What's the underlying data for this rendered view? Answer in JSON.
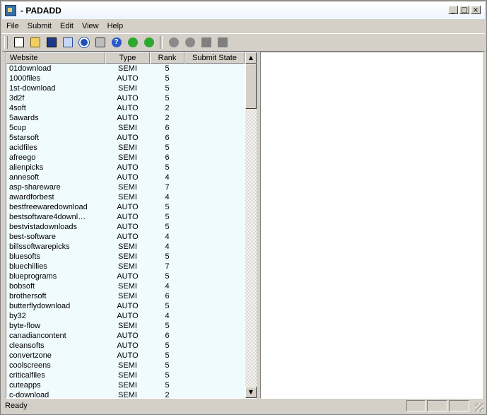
{
  "window": {
    "title": "- PADADD",
    "min": "_",
    "max": "□",
    "close": "×"
  },
  "menu": [
    "File",
    "Submit",
    "Edit",
    "View",
    "Help"
  ],
  "list": {
    "headers": {
      "website": "Website",
      "type": "Type",
      "rank": "Rank",
      "state": "Submit State"
    },
    "rows": [
      [
        "01download",
        "SEMI",
        "5"
      ],
      [
        "1000files",
        "AUTO",
        "5"
      ],
      [
        "1st-download",
        "SEMI",
        "5"
      ],
      [
        "3d2f",
        "AUTO",
        "5"
      ],
      [
        "4soft",
        "AUTO",
        "2"
      ],
      [
        "5awards",
        "AUTO",
        "2"
      ],
      [
        "5cup",
        "SEMI",
        "6"
      ],
      [
        "5starsoft",
        "AUTO",
        "6"
      ],
      [
        "acidfiles",
        "SEMI",
        "5"
      ],
      [
        "afreego",
        "SEMI",
        "6"
      ],
      [
        "alienpicks",
        "AUTO",
        "5"
      ],
      [
        "annesoft",
        "AUTO",
        "4"
      ],
      [
        "asp-shareware",
        "SEMI",
        "7"
      ],
      [
        "awardforbest",
        "SEMI",
        "4"
      ],
      [
        "bestfreewaredownload",
        "AUTO",
        "5"
      ],
      [
        "bestsoftware4downl…",
        "AUTO",
        "5"
      ],
      [
        "bestvistadownloads",
        "AUTO",
        "5"
      ],
      [
        "best-software",
        "AUTO",
        "4"
      ],
      [
        "billssoftwarepicks",
        "SEMI",
        "4"
      ],
      [
        "bluesofts",
        "SEMI",
        "5"
      ],
      [
        "bluechillies",
        "SEMI",
        "7"
      ],
      [
        "blueprograms",
        "AUTO",
        "5"
      ],
      [
        "bobsoft",
        "SEMI",
        "4"
      ],
      [
        "brothersoft",
        "SEMI",
        "6"
      ],
      [
        "butterflydownload",
        "AUTO",
        "5"
      ],
      [
        "by32",
        "AUTO",
        "4"
      ],
      [
        "byte-flow",
        "SEMI",
        "5"
      ],
      [
        "canadiancontent",
        "AUTO",
        "6"
      ],
      [
        "cleansofts",
        "AUTO",
        "5"
      ],
      [
        "convertzone",
        "AUTO",
        "5"
      ],
      [
        "coolscreens",
        "SEMI",
        "5"
      ],
      [
        "criticalfiles",
        "SEMI",
        "5"
      ],
      [
        "cuteapps",
        "SEMI",
        "5"
      ],
      [
        "c-download",
        "SEMI",
        "2"
      ]
    ]
  },
  "scroll": {
    "up": "▲",
    "down": "▼"
  },
  "status": {
    "text": "Ready"
  }
}
